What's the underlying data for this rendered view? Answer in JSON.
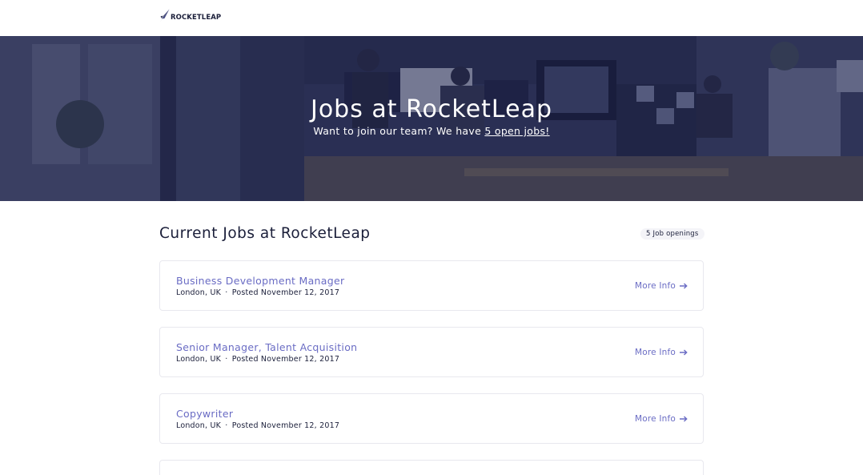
{
  "header": {
    "logo_text": "ROCKETLEAP",
    "logo_icon": "rocket-icon"
  },
  "hero": {
    "title": "Jobs at RocketLeap",
    "subtitle_before": "Want to join our team? We have ",
    "subtitle_link": "5 open jobs!"
  },
  "listing": {
    "section_title": "Current Jobs at RocketLeap",
    "openings_badge": "5 Job openings"
  },
  "jobs": [
    {
      "title": "Business Development Manager",
      "location": "London, UK",
      "separator": "·",
      "posted": "Posted November 12, 2017",
      "more_info": "More Info",
      "arrow_icon": "arrow-right-icon"
    },
    {
      "title": "Senior Manager, Talent Acquisition",
      "location": "London, UK",
      "separator": "·",
      "posted": "Posted November 12, 2017",
      "more_info": "More Info",
      "arrow_icon": "arrow-right-icon"
    },
    {
      "title": "Copywriter",
      "location": "London, UK",
      "separator": "·",
      "posted": "Posted November 12, 2017",
      "more_info": "More Info",
      "arrow_icon": "arrow-right-icon"
    }
  ],
  "colors": {
    "accent": "#6a6cc4",
    "text": "#1b1f3a",
    "hero_overlay": "#1e2248",
    "card_border": "#e8e8ee"
  }
}
